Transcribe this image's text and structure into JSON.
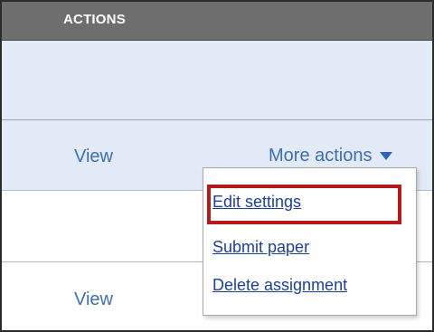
{
  "table": {
    "column_header": "ACTIONS",
    "rows": [
      {
        "view_label": "View",
        "more_actions_label": "More actions"
      },
      {
        "view_label": "View"
      }
    ]
  },
  "dropdown": {
    "items": [
      {
        "label": "Edit settings",
        "highlighted": true
      },
      {
        "label": "Submit paper"
      },
      {
        "label": "Delete assignment"
      }
    ]
  },
  "icons": {
    "more_actions_caret": "caret-down-icon"
  },
  "colors": {
    "header_bg": "#6e6e6e",
    "row_highlight_bg": "#e1eaf6",
    "link": "#3d6fb0",
    "menu_link": "#1c3f9a",
    "highlight_border": "#b51b1b"
  }
}
